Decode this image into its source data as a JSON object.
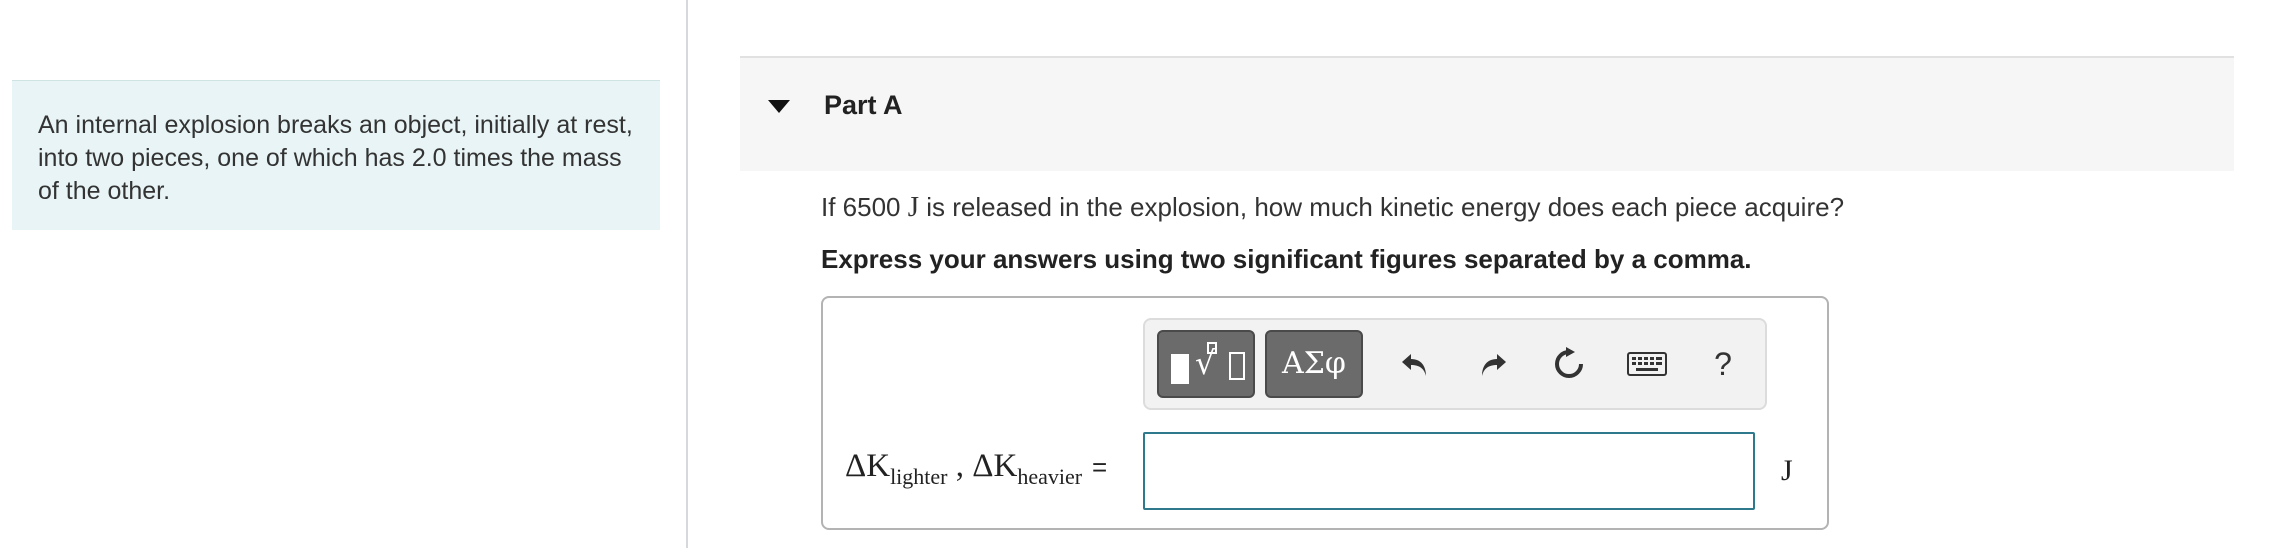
{
  "problem": {
    "intro": "An internal explosion breaks an object, initially at rest, into two pieces, one of which has 2.0 times the mass of the other."
  },
  "part": {
    "title": "Part A",
    "question_prefix": "If 6500 ",
    "question_unit": "J",
    "question_suffix": " is released in the explosion, how much kinetic energy does each piece acquire?",
    "instruction": "Express your answers using two significant figures separated by a comma."
  },
  "toolbar": {
    "greek_label": "ΑΣφ",
    "help_label": "?",
    "icons": [
      "templates-icon",
      "greek-symbols-icon",
      "undo-icon",
      "redo-icon",
      "reset-icon",
      "keyboard-icon",
      "help-icon"
    ]
  },
  "answer": {
    "label_delta1": "ΔK",
    "label_sub1": "lighter",
    "label_sep": " , ",
    "label_delta2": "ΔK",
    "label_sub2": "heavier",
    "label_eq": "=",
    "value": "",
    "unit": "J"
  },
  "colors": {
    "intro_bg": "#e8f4f5",
    "input_border": "#2e7a8c",
    "toolbar_button": "#6b6b6b"
  }
}
